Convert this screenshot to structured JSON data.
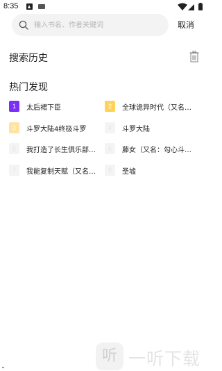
{
  "status_bar": {
    "time": "8:35",
    "icons": [
      "a-notification-icon",
      "keyboard-icon",
      "wifi-icon",
      "signal-icon",
      "battery-icon"
    ]
  },
  "search": {
    "placeholder": "输入书名、作者关键词",
    "value": "",
    "cancel_label": "取消"
  },
  "history": {
    "title": "搜索历史",
    "delete_icon": "trash-icon"
  },
  "hot": {
    "title": "热门发现",
    "items": [
      {
        "rank": "1",
        "title": "太后裙下臣",
        "badge_color": "#7b2ff7"
      },
      {
        "rank": "2",
        "title": "全球诡异时代（又名…",
        "badge_color": "#ffd35a"
      },
      {
        "rank": "3",
        "title": "斗罗大陆4终极斗罗",
        "badge_color": "#ffe3a3"
      },
      {
        "rank": "4",
        "title": "斗罗大陆",
        "badge_color": "#f4f4f4"
      },
      {
        "rank": "5",
        "title": "我打造了长生俱乐部…",
        "badge_color": "#f4f4f4"
      },
      {
        "rank": "6",
        "title": "藤女（又名：勾心斗…",
        "badge_color": "#f4f4f4"
      },
      {
        "rank": "7",
        "title": "我能复制天赋（又名…",
        "badge_color": "#f4f4f4"
      },
      {
        "rank": "8",
        "title": "圣墟",
        "badge_color": "#f4f4f4"
      }
    ]
  },
  "watermark": {
    "logo_glyph": "听",
    "text": "一听下载"
  }
}
